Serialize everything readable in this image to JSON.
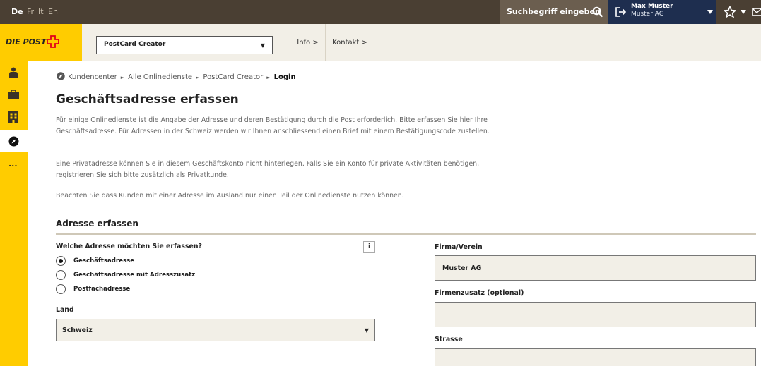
{
  "languages": [
    "De",
    "Fr",
    "It",
    "En"
  ],
  "search": {
    "placeholder": "Suchbegriff eingeben"
  },
  "user": {
    "name": "Max Muster",
    "company": "Muster AG"
  },
  "logo": "DIE POST",
  "service_select": {
    "value": "PostCard Creator"
  },
  "nav": {
    "info": "Info >",
    "kontakt": "Kontakt >"
  },
  "sidebar": {
    "more": "..."
  },
  "breadcrumb": {
    "items": [
      "Kundencenter",
      "Alle Onlinedienste",
      "PostCard Creator"
    ],
    "current": "Login"
  },
  "page": {
    "title": "Geschäftsadresse erfassen",
    "para1": "Für einige Onlinedienste ist die Angabe der Adresse und deren Bestätigung durch die Post erforderlich. Bitte erfassen Sie hier Ihre Geschäftsadresse. Für Adressen in der Schweiz werden wir Ihnen anschliessend einen Brief mit einem Bestätigungscode zustellen.",
    "para2": "Eine Privatadresse können Sie in diesem Geschäftskonto nicht hinterlegen. Falls Sie ein Konto für private Aktivitäten benötigen, registrieren Sie sich bitte zusätzlich als Privatkunde.",
    "para3": "Beachten Sie dass Kunden mit einer Adresse im Ausland nur einen Teil der Onlinedienste nutzen können."
  },
  "form": {
    "section_title": "Adresse erfassen",
    "question": "Welche Adresse möchten Sie erfassen?",
    "info_icon": "i",
    "options": [
      {
        "label": "Geschäftsadresse",
        "checked": true
      },
      {
        "label": "Geschäftsadresse mit Adresszusatz",
        "checked": false
      },
      {
        "label": "Postfachadresse",
        "checked": false
      }
    ],
    "land_label": "Land",
    "land_value": "Schweiz",
    "firma_label": "Firma/Verein",
    "firma_value": "Muster AG",
    "firmenzusatz_label": "Firmenzusatz (optional)",
    "firmenzusatz_value": "",
    "strasse_label": "Strasse",
    "strasse_value": ""
  },
  "colors": {
    "brand_yellow": "#ffcc00",
    "topbar": "#4a3f33",
    "user_blue": "#1e2e4f"
  }
}
